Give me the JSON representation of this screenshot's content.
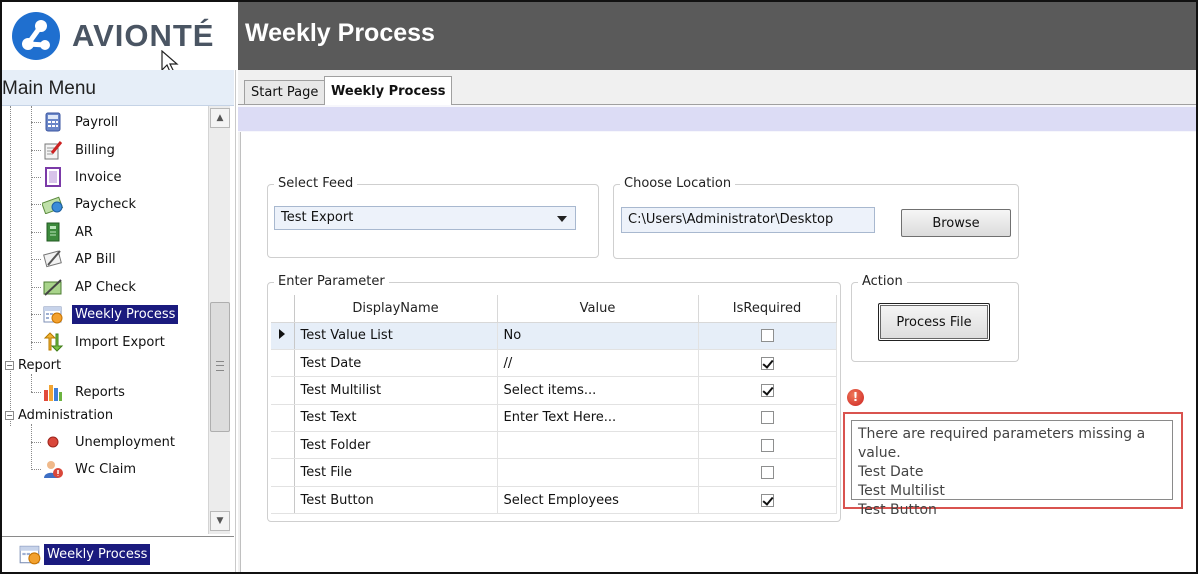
{
  "header": {
    "logo_text": "AVIONTÉ",
    "page_title": "Weekly Process"
  },
  "sidebar": {
    "title": "Main Menu",
    "items": [
      {
        "label": "Payroll",
        "icon": "calculator-icon"
      },
      {
        "label": "Billing",
        "icon": "billing-icon"
      },
      {
        "label": "Invoice",
        "icon": "invoice-icon"
      },
      {
        "label": "Paycheck",
        "icon": "paycheck-icon"
      },
      {
        "label": "AR",
        "icon": "ledger-icon"
      },
      {
        "label": "AP Bill",
        "icon": "ap-bill-icon"
      },
      {
        "label": "AP Check",
        "icon": "ap-check-icon"
      },
      {
        "label": "Weekly Process",
        "icon": "weekly-calendar-icon",
        "selected": true
      },
      {
        "label": "Import Export",
        "icon": "import-export-icon"
      }
    ],
    "groups": [
      {
        "label": "Report",
        "items": [
          {
            "label": "Reports",
            "icon": "reports-chart-icon"
          }
        ]
      },
      {
        "label": "Administration",
        "items": [
          {
            "label": "Unemployment",
            "icon": "red-dot-icon"
          },
          {
            "label": "Wc Claim",
            "icon": "wc-claim-user-icon"
          }
        ]
      }
    ],
    "footer_item": "Weekly Process"
  },
  "tabs": [
    {
      "label": "Start Page",
      "active": false
    },
    {
      "label": "Weekly Process",
      "active": true
    }
  ],
  "select_feed": {
    "legend": "Select Feed",
    "value": "Test Export"
  },
  "choose_location": {
    "legend": "Choose Location",
    "path": "C:\\Users\\Administrator\\Desktop",
    "browse_label": "Browse"
  },
  "parameters": {
    "legend": "Enter Parameter",
    "columns": [
      "DisplayName",
      "Value",
      "IsRequired"
    ],
    "rows": [
      {
        "name": "Test Value List",
        "value": "No",
        "required": false
      },
      {
        "name": "Test Date",
        "value": "//",
        "required": true
      },
      {
        "name": "Test Multilist",
        "value": "Select items...",
        "required": true
      },
      {
        "name": "Test Text",
        "value": "Enter Text Here...",
        "required": false
      },
      {
        "name": "Test Folder",
        "value": "",
        "required": false
      },
      {
        "name": "Test File",
        "value": "",
        "required": false
      },
      {
        "name": "Test Button",
        "value": "Select Employees",
        "required": true
      }
    ]
  },
  "action": {
    "legend": "Action",
    "process_label": "Process File"
  },
  "error": {
    "icon_glyph": "!",
    "lines": [
      "There are required parameters missing a value.",
      "Test Date",
      "Test Multilist",
      "Test Button"
    ],
    "outline_color": "#d9534f"
  },
  "colors": {
    "selected_bg": "#1a1a7e",
    "title_bar": "#5a5a5a",
    "brand_blue": "#1f6fcf"
  }
}
